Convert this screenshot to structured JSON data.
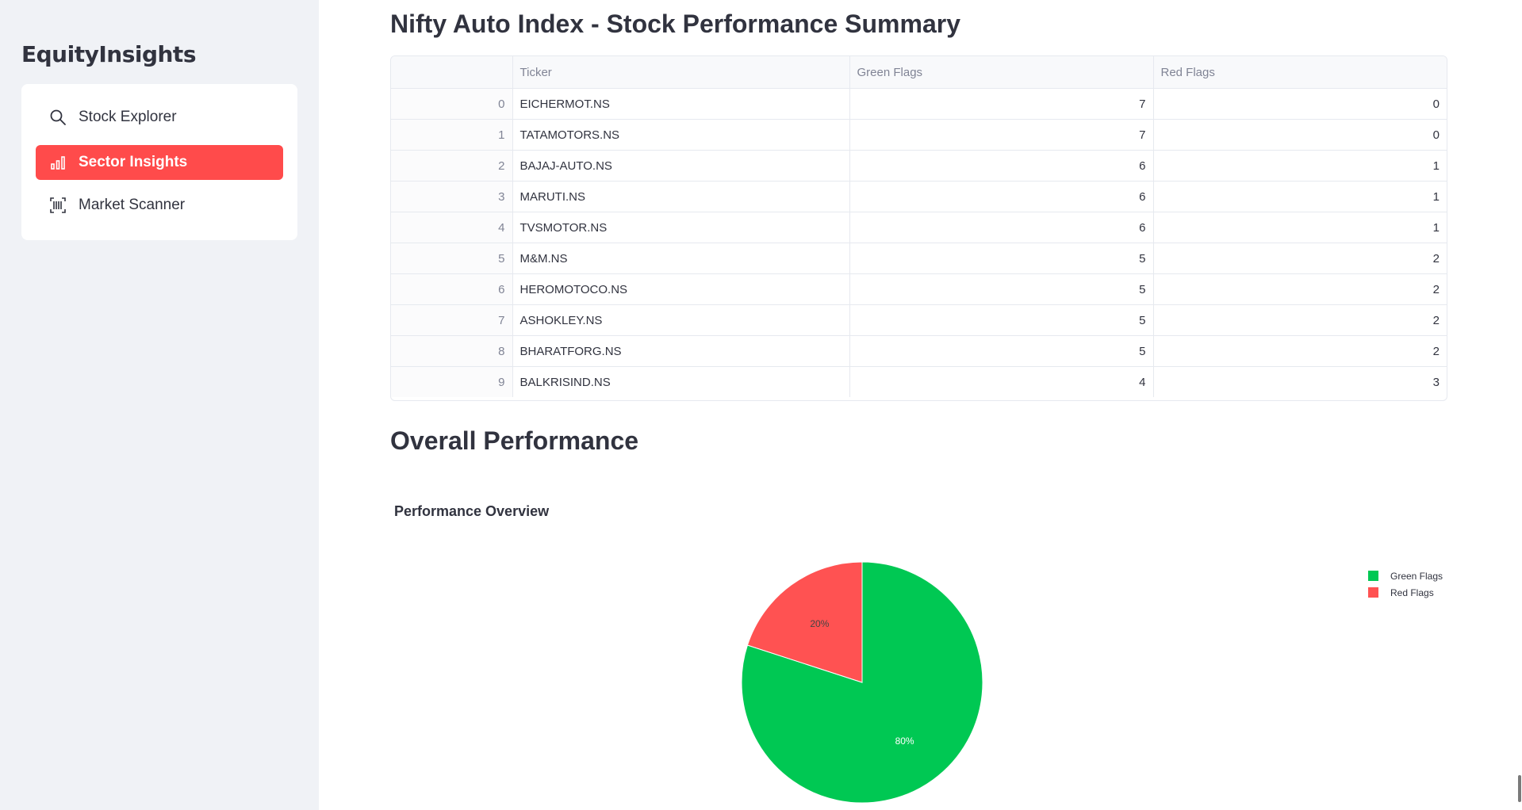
{
  "sidebar": {
    "brand": "EquityInsights",
    "items": [
      {
        "label": "Stock Explorer",
        "icon": "search-icon"
      },
      {
        "label": "Sector Insights",
        "icon": "bar-chart-icon",
        "active": true
      },
      {
        "label": "Market Scanner",
        "icon": "barcode-scan-icon"
      }
    ]
  },
  "main": {
    "title": "Nifty Auto Index - Stock Performance Summary",
    "table": {
      "columns": [
        "",
        "Ticker",
        "Green Flags",
        "Red Flags"
      ],
      "rows": [
        [
          "0",
          "EICHERMOT.NS",
          "7",
          "0"
        ],
        [
          "1",
          "TATAMOTORS.NS",
          "7",
          "0"
        ],
        [
          "2",
          "BAJAJ-AUTO.NS",
          "6",
          "1"
        ],
        [
          "3",
          "MARUTI.NS",
          "6",
          "1"
        ],
        [
          "4",
          "TVSMOTOR.NS",
          "6",
          "1"
        ],
        [
          "5",
          "M&M.NS",
          "5",
          "2"
        ],
        [
          "6",
          "HEROMOTOCO.NS",
          "5",
          "2"
        ],
        [
          "7",
          "ASHOKLEY.NS",
          "5",
          "2"
        ],
        [
          "8",
          "BHARATFORG.NS",
          "5",
          "2"
        ],
        [
          "9",
          "BALKRISIND.NS",
          "4",
          "3"
        ]
      ]
    },
    "section_title": "Overall Performance"
  },
  "colors": {
    "accent": "#ff4b4b",
    "green": "#00c853",
    "red": "#ff5252"
  },
  "chart_data": {
    "type": "pie",
    "title": "Performance Overview",
    "categories": [
      "Green Flags",
      "Red Flags"
    ],
    "values": [
      80,
      20
    ],
    "labels": [
      "80%",
      "20%"
    ],
    "colors": [
      "#00c853",
      "#ff5252"
    ],
    "legend_position": "top-right"
  }
}
